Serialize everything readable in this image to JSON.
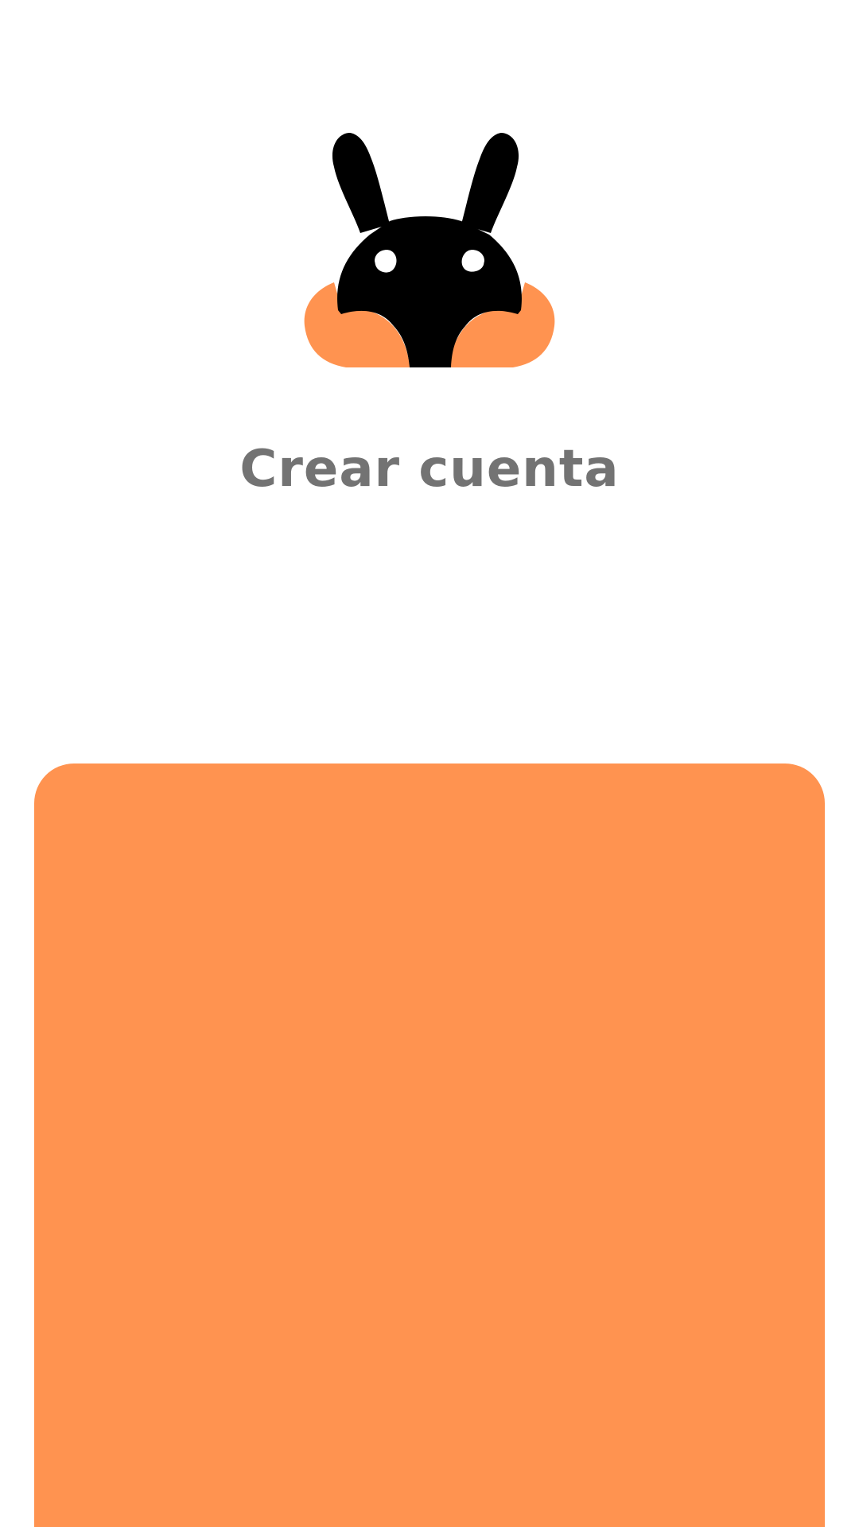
{
  "app": {
    "logo_icon": "bunny-mascot-icon",
    "brand_color": "#FF9350",
    "logo_color": "#000000"
  },
  "header": {
    "title": "Crear cuenta"
  },
  "panel": {
    "color": "#FF9350"
  }
}
